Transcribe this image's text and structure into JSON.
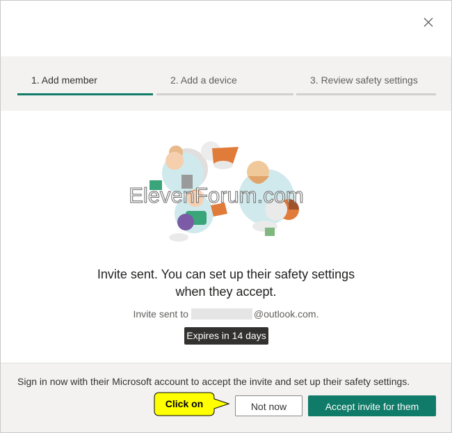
{
  "dialog": {
    "close_icon": "close-icon",
    "steps": [
      {
        "label": "1. Add member",
        "active": true
      },
      {
        "label": "2. Add a device",
        "active": false
      },
      {
        "label": "3. Review safety settings",
        "active": false
      }
    ],
    "headline_line1": "Invite sent. You can set up their safety settings",
    "headline_line2": "when they accept.",
    "invite_sent_prefix": "Invite sent to",
    "invite_sent_domain": "@outlook.com.",
    "expires_badge": "Expires in 14 days"
  },
  "footer": {
    "text": "Sign in now with their Microsoft account to accept the invite and set up their safety settings.",
    "not_now_label": "Not now",
    "accept_label": "Accept invite for them"
  },
  "annotation": {
    "callout_label": "Click on",
    "watermark": "ElevenForum.com"
  },
  "colors": {
    "accent": "#0f7b68",
    "stepper_bg": "#f3f2f1",
    "callout_fill": "#ffff00"
  }
}
